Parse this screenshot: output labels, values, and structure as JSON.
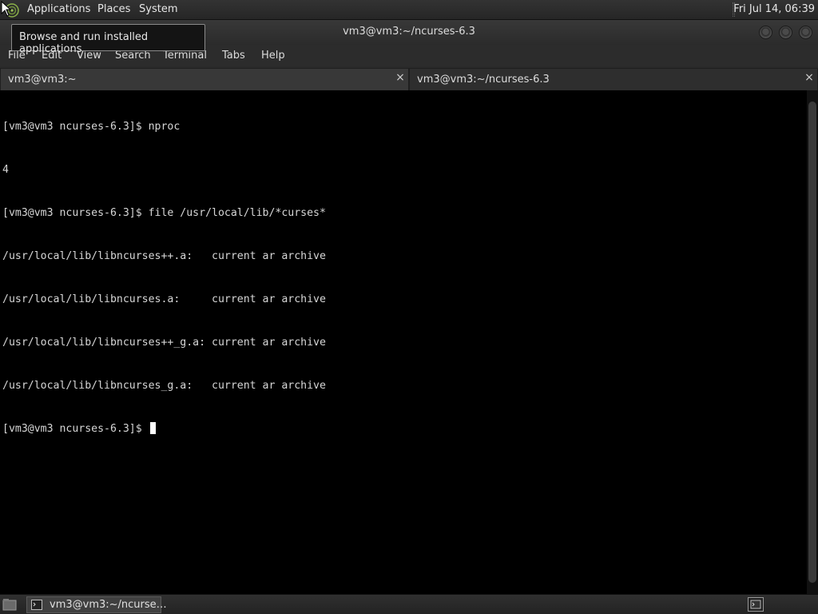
{
  "top_panel": {
    "menus": [
      "Applications",
      "Places",
      "System"
    ],
    "clock": "Fri Jul 14, 06:39"
  },
  "tooltip": {
    "text": "Browse and run installed applications"
  },
  "window": {
    "title": "vm3@vm3:~/ncurses-6.3",
    "menubar": [
      "File",
      "Edit",
      "View",
      "Search",
      "Terminal",
      "Tabs",
      "Help"
    ],
    "tabs": [
      {
        "label": "vm3@vm3:~",
        "close": "×"
      },
      {
        "label": "vm3@vm3:~/ncurses-6.3",
        "close": "×"
      }
    ]
  },
  "terminal": {
    "lines": [
      "[vm3@vm3 ncurses-6.3]$ nproc",
      "4",
      "[vm3@vm3 ncurses-6.3]$ file /usr/local/lib/*curses*",
      "/usr/local/lib/libncurses++.a:   current ar archive",
      "/usr/local/lib/libncurses.a:     current ar archive",
      "/usr/local/lib/libncurses++_g.a: current ar archive",
      "/usr/local/lib/libncurses_g.a:   current ar archive"
    ],
    "prompt": "[vm3@vm3 ncurses-6.3]$ "
  },
  "bottom_panel": {
    "taskbar_item": "vm3@vm3:~/ncurse…"
  },
  "colors": {
    "terminal_bg": "#000000",
    "terminal_fg": "#d6d6d6",
    "panel_bg": "#2b2b2b"
  }
}
